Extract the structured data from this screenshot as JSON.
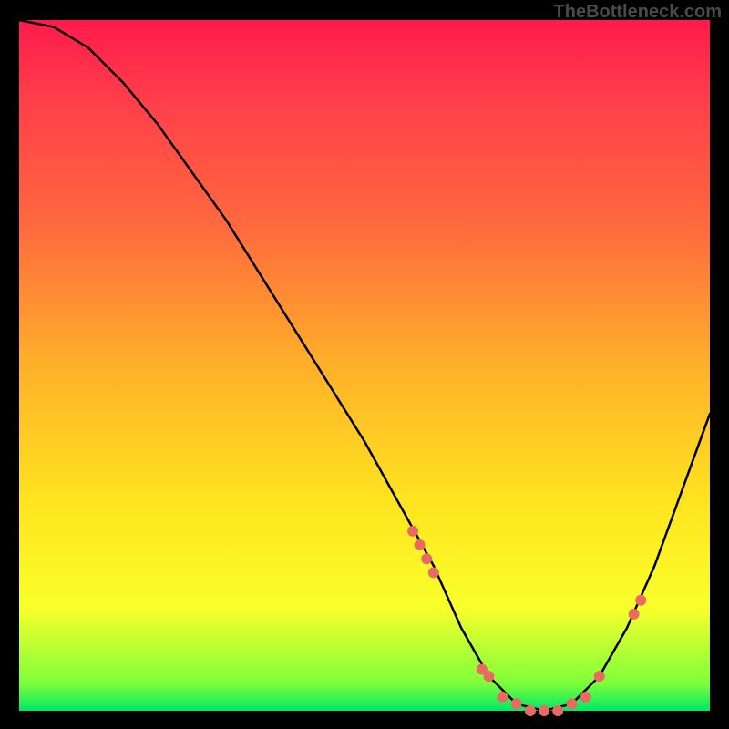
{
  "watermark": "TheBottleneck.com",
  "chart_data": {
    "type": "line",
    "title": "",
    "xlabel": "",
    "ylabel": "",
    "xlim": [
      0,
      100
    ],
    "ylim": [
      0,
      100
    ],
    "x": [
      0,
      5,
      10,
      15,
      20,
      25,
      30,
      35,
      40,
      45,
      50,
      55,
      60,
      64,
      68,
      72,
      76,
      80,
      84,
      88,
      92,
      96,
      100
    ],
    "values": [
      100,
      99,
      96,
      91,
      85,
      78,
      71,
      63,
      55,
      47,
      39,
      30,
      21,
      12,
      5,
      1,
      0,
      1,
      5,
      12,
      21,
      32,
      43
    ],
    "highlight_points": {
      "x": [
        57,
        58,
        59,
        60,
        67,
        68,
        70,
        72,
        74,
        76,
        78,
        80,
        82,
        84,
        89,
        90
      ],
      "y": [
        26,
        24,
        22,
        20,
        6,
        5,
        2,
        1,
        0,
        0,
        0,
        1,
        2,
        5,
        14,
        16
      ]
    },
    "gradient_stops": [
      {
        "pos": 0.0,
        "color": "#ff1a4b"
      },
      {
        "pos": 0.1,
        "color": "#ff3a4b"
      },
      {
        "pos": 0.3,
        "color": "#ff6a3d"
      },
      {
        "pos": 0.5,
        "color": "#ffb029"
      },
      {
        "pos": 0.7,
        "color": "#ffe51f"
      },
      {
        "pos": 0.85,
        "color": "#f9ff2a"
      },
      {
        "pos": 0.96,
        "color": "#7fff3a"
      },
      {
        "pos": 1.0,
        "color": "#00e866"
      }
    ]
  }
}
